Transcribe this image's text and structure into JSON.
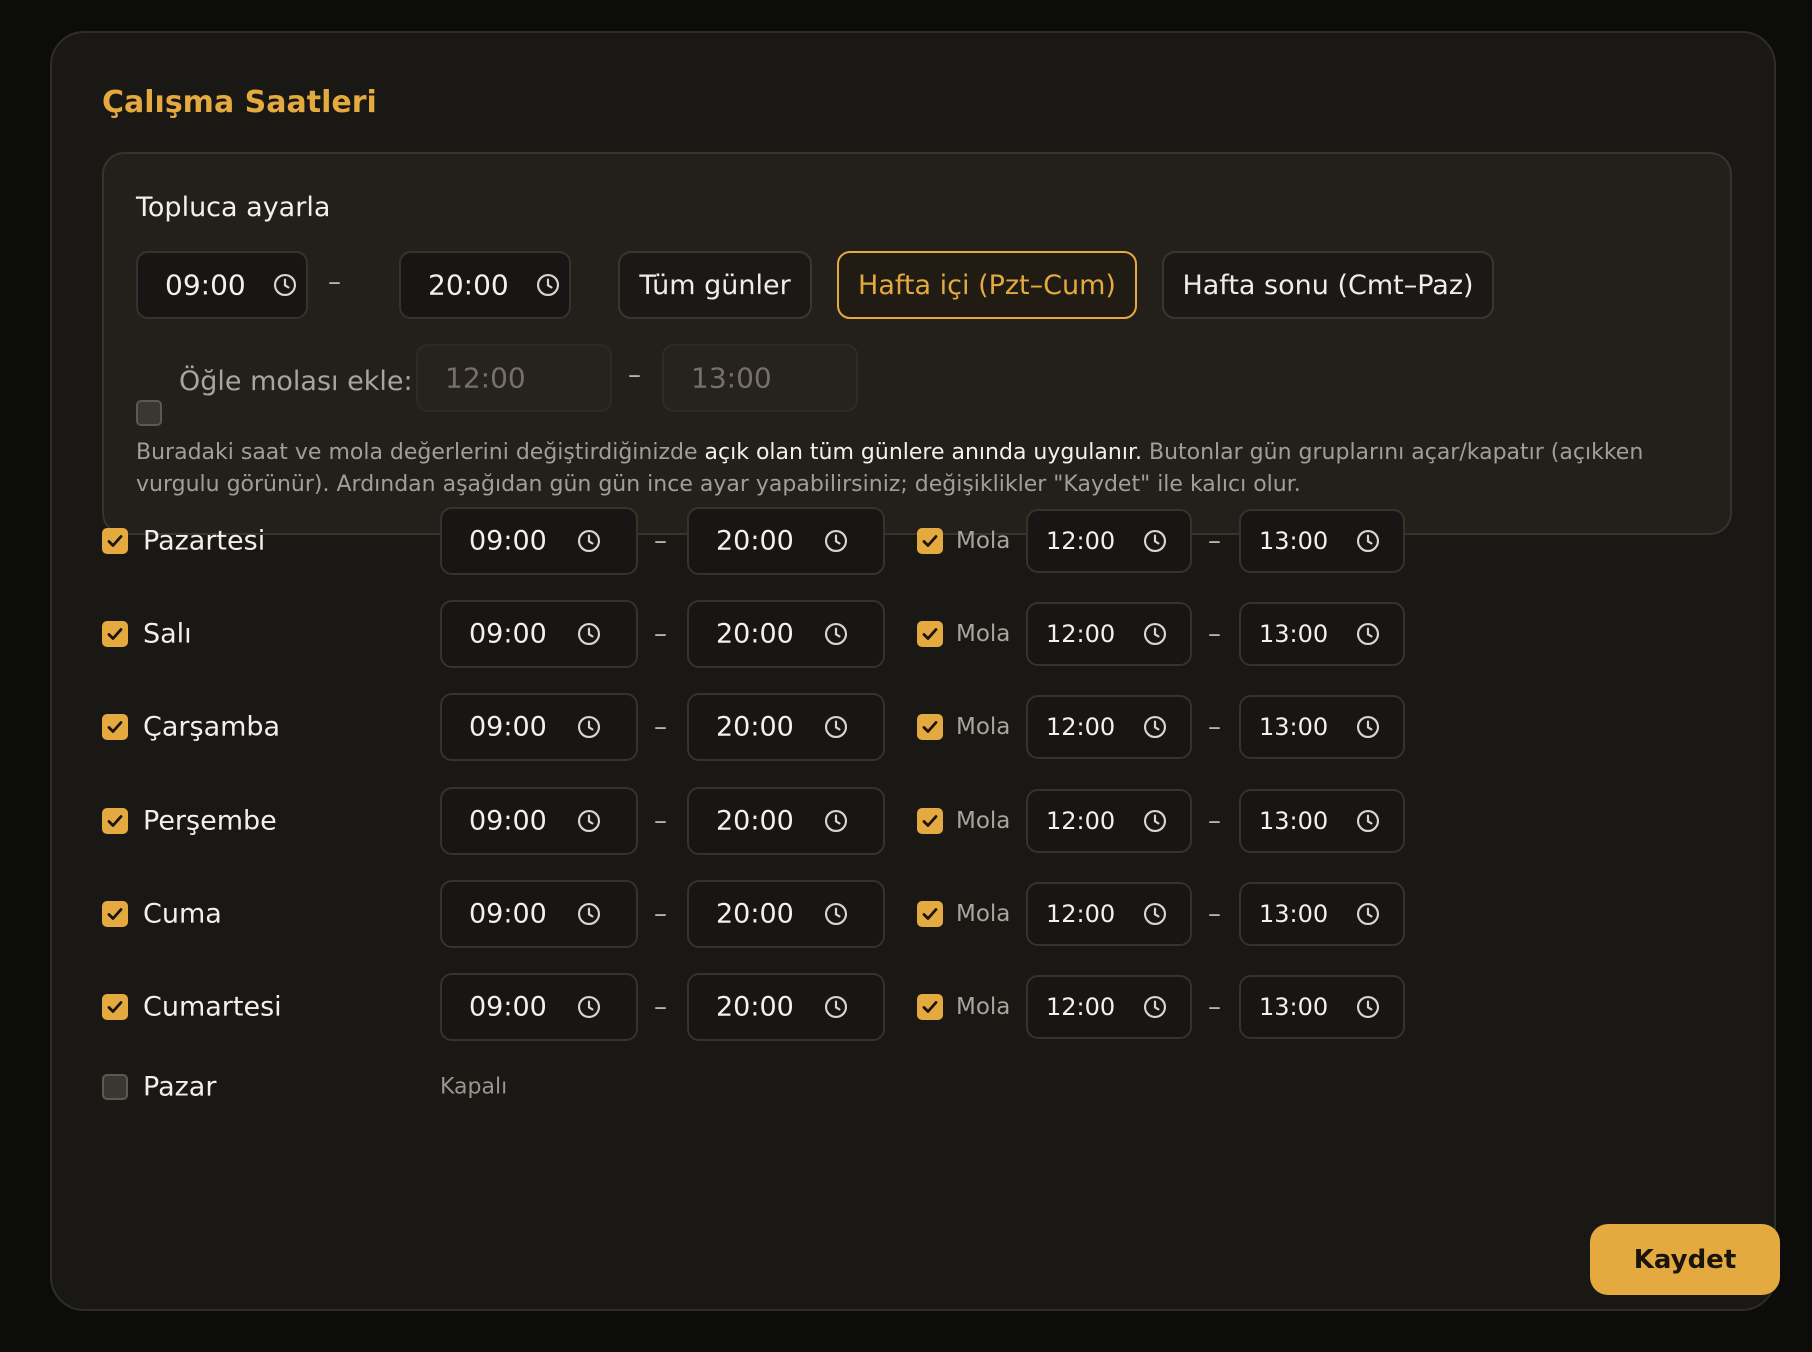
{
  "title": "Çalışma Saatleri",
  "colors": {
    "accent": "#e4a93f",
    "background": "#191815",
    "panel": "#23201b"
  },
  "bulk": {
    "title": "Topluca ayarla",
    "start": "09:00",
    "end": "20:00",
    "separator": "–",
    "presets": [
      {
        "label": "Tüm günler",
        "active": false
      },
      {
        "label": "Hafta içi (Pzt–Cum)",
        "active": true
      },
      {
        "label": "Hafta sonu (Cmt–Paz)",
        "active": false
      }
    ],
    "lunch": {
      "checked": false,
      "label": "Öğle molası ekle:",
      "start_placeholder": "12:00",
      "end_placeholder": "13:00"
    },
    "help_pre": "Buradaki saat ve mola değerlerini değiştirdiğinizde ",
    "help_highlight": "açık olan tüm günlere anında uygulanır.",
    "help_post": " Butonlar gün gruplarını açar/kapatır (açıkken vurgulu görünür). Ardından aşağıdan gün gün ince ayar yapabilirsiniz; değişiklikler \"Kaydet\" ile kalıcı olur."
  },
  "days": [
    {
      "name": "Pazartesi",
      "enabled": true,
      "start": "09:00",
      "end": "20:00",
      "break_enabled": true,
      "break_label": "Mola",
      "break_start": "12:00",
      "break_end": "13:00"
    },
    {
      "name": "Salı",
      "enabled": true,
      "start": "09:00",
      "end": "20:00",
      "break_enabled": true,
      "break_label": "Mola",
      "break_start": "12:00",
      "break_end": "13:00"
    },
    {
      "name": "Çarşamba",
      "enabled": true,
      "start": "09:00",
      "end": "20:00",
      "break_enabled": true,
      "break_label": "Mola",
      "break_start": "12:00",
      "break_end": "13:00"
    },
    {
      "name": "Perşembe",
      "enabled": true,
      "start": "09:00",
      "end": "20:00",
      "break_enabled": true,
      "break_label": "Mola",
      "break_start": "12:00",
      "break_end": "13:00"
    },
    {
      "name": "Cuma",
      "enabled": true,
      "start": "09:00",
      "end": "20:00",
      "break_enabled": true,
      "break_label": "Mola",
      "break_start": "12:00",
      "break_end": "13:00"
    },
    {
      "name": "Cumartesi",
      "enabled": true,
      "start": "09:00",
      "end": "20:00",
      "break_enabled": true,
      "break_label": "Mola",
      "break_start": "12:00",
      "break_end": "13:00"
    },
    {
      "name": "Pazar",
      "enabled": false,
      "closed_label": "Kapalı"
    }
  ],
  "save_label": "Kaydet"
}
